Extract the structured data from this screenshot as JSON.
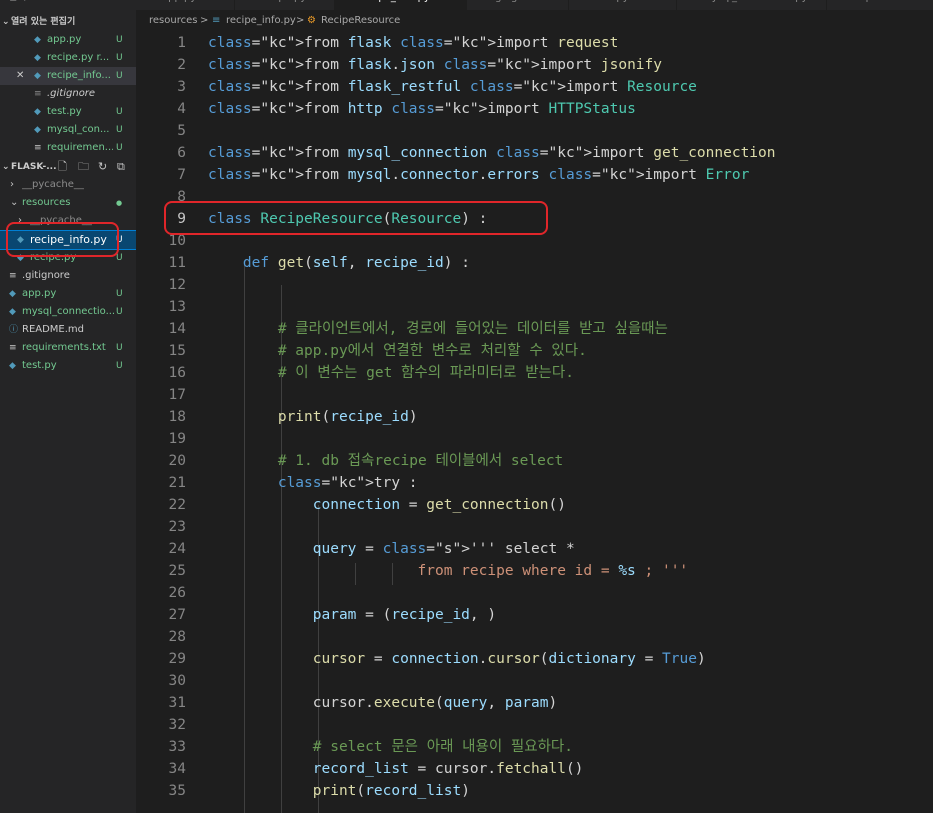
{
  "sidebar": {
    "top_cut": "열려",
    "open_editors_title": "열려 있는 편집기",
    "open_editors": [
      {
        "name": "app.py",
        "badge": "U",
        "close": ""
      },
      {
        "name": "recipe.py r...",
        "badge": "U",
        "close": ""
      },
      {
        "name": "recipe_info...",
        "badge": "U",
        "close": "✕"
      },
      {
        "name": ".gitignore",
        "badge": "",
        "close": ""
      },
      {
        "name": "test.py",
        "badge": "U",
        "close": ""
      },
      {
        "name": "mysql_con...",
        "badge": "U",
        "close": ""
      },
      {
        "name": "requiremen...",
        "badge": "U",
        "close": ""
      }
    ],
    "project_title": "FLASK-...",
    "tree": [
      {
        "name": "__pycache__",
        "badge": ""
      },
      {
        "name": "resources",
        "badge": "●"
      },
      {
        "name": "__pycache__",
        "badge": ""
      },
      {
        "name": "recipe_info.py",
        "badge": "U"
      },
      {
        "name": "recipe.py",
        "badge": "U"
      },
      {
        "name": ".gitignore",
        "badge": ""
      },
      {
        "name": "app.py",
        "badge": "U"
      },
      {
        "name": "mysql_connectio...",
        "badge": "U"
      },
      {
        "name": "README.md",
        "badge": ""
      },
      {
        "name": "requirements.txt",
        "badge": "U"
      },
      {
        "name": "test.py",
        "badge": "U"
      }
    ]
  },
  "tabs": [
    {
      "label": "app.py  U"
    },
    {
      "label": "recipe.py  U"
    },
    {
      "label": "recipe_info.py  U  ✕"
    },
    {
      "label": ".gitignore"
    },
    {
      "label": "test.py  U"
    },
    {
      "label": "mysql_connection.py  U"
    },
    {
      "label": "requirements.txt"
    }
  ],
  "breadcrumb": {
    "folder": "resources",
    "sep1": ">",
    "file": "recipe_info.py",
    "sep2": ">",
    "symbol": "RecipeResource"
  },
  "editor": {
    "current_line": 9,
    "lines": [
      {
        "n": "1",
        "t": "from flask import request"
      },
      {
        "n": "2",
        "t": "from flask.json import jsonify"
      },
      {
        "n": "3",
        "t": "from flask_restful import Resource"
      },
      {
        "n": "4",
        "t": "from http import HTTPStatus"
      },
      {
        "n": "5",
        "t": ""
      },
      {
        "n": "6",
        "t": "from mysql_connection import get_connection"
      },
      {
        "n": "7",
        "t": "from mysql.connector.errors import Error"
      },
      {
        "n": "8",
        "t": ""
      },
      {
        "n": "9",
        "t": "class RecipeResource(Resource) :"
      },
      {
        "n": "10",
        "t": ""
      },
      {
        "n": "11",
        "t": "    def get(self, recipe_id) :"
      },
      {
        "n": "12",
        "t": ""
      },
      {
        "n": "13",
        "t": ""
      },
      {
        "n": "14",
        "t": "        # 클라이언트에서, 경로에 들어있는 데이터를 받고 싶을때는"
      },
      {
        "n": "15",
        "t": "        # app.py에서 연결한 변수로 처리할 수 있다."
      },
      {
        "n": "16",
        "t": "        # 이 변수는 get 함수의 파라미터로 받는다."
      },
      {
        "n": "17",
        "t": ""
      },
      {
        "n": "18",
        "t": "        print(recipe_id)"
      },
      {
        "n": "19",
        "t": ""
      },
      {
        "n": "20",
        "t": "        # 1. db 접속recipe 테이블에서 select"
      },
      {
        "n": "21",
        "t": "        try :"
      },
      {
        "n": "22",
        "t": "            connection = get_connection()"
      },
      {
        "n": "23",
        "t": ""
      },
      {
        "n": "24",
        "t": "            query = ''' select *"
      },
      {
        "n": "25",
        "t": "                        from recipe where id = %s ; '''"
      },
      {
        "n": "26",
        "t": ""
      },
      {
        "n": "27",
        "t": "            param = (recipe_id, )"
      },
      {
        "n": "28",
        "t": ""
      },
      {
        "n": "29",
        "t": "            cursor = connection.cursor(dictionary = True)"
      },
      {
        "n": "30",
        "t": ""
      },
      {
        "n": "31",
        "t": "            cursor.execute(query, param)"
      },
      {
        "n": "32",
        "t": ""
      },
      {
        "n": "33",
        "t": "            # select 문은 아래 내용이 필요하다."
      },
      {
        "n": "34",
        "t": "            record_list = cursor.fetchall()"
      },
      {
        "n": "35",
        "t": "            print(record_list)"
      }
    ]
  },
  "colors": {
    "keyword": "#569cd6",
    "import_keyword": "#c586c0",
    "class_name": "#4ec9b0",
    "function": "#dcdcaa",
    "variable": "#9cdcfe",
    "string": "#ce9178",
    "comment": "#6a9955",
    "untracked": "#73c991",
    "annotation": "#e0262a"
  }
}
